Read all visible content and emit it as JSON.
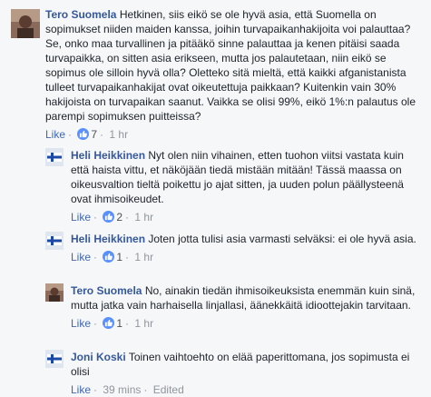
{
  "comments": [
    {
      "author": "Tero Suomela",
      "text": "Hetkinen, siis eikö se ole hyvä asia, että Suomella on sopimukset niiden maiden kanssa, joihin turvapaikanhakijoita voi palauttaa? Se, onko maa turvallinen ja pitääkö sinne palauttaa ja kenen pitäisi saada turvapaikka, on sitten asia erikseen, mutta jos palautetaan, niin eikö se sopimus ole silloin hyvä olla? Oletteko sitä mieltä, että kaikki afganistanista tulleet turvapaikanhakijat ovat oikeutettuja paikkaan? Kuitenkin vain 30% hakijoista on turvapaikan saanut. Vaikka se olisi 99%, eikö 1%:n palautus ole parempi sopimuksen puitteissa?",
      "like_label": "Like",
      "reaction_count": "7",
      "time": "1 hr",
      "edited": ""
    },
    {
      "author": "Heli Heikkinen",
      "text": "Nyt olen niin vihainen, etten tuohon viitsi vastata kuin että haista vittu, et näköjään tiedä mistään mitään! Tässä maassa on oikeusvaltion tieltä poikettu jo ajat sitten, ja uuden polun päällysteenä ovat ihmisoikeudet.",
      "like_label": "Like",
      "reaction_count": "2",
      "time": "1 hr",
      "edited": ""
    },
    {
      "author": "Heli Heikkinen",
      "text": "Joten jotta tulisi asia varmasti selväksi: ei ole hyvä asia.",
      "like_label": "Like",
      "reaction_count": "1",
      "time": "1 hr",
      "edited": ""
    },
    {
      "author": "Tero Suomela",
      "text": "No, ainakin tiedän ihmisoikeuksista enemmän kuin sinä, mutta jatka vain harhaisella linjallasi, äänekkäitä idioottejakin tarvitaan.",
      "like_label": "Like",
      "reaction_count": "1",
      "time": "1 hr",
      "edited": ""
    },
    {
      "author": "Joni Koski",
      "text": "Toinen vaihtoehto on elää paperittomana, jos sopimusta ei olisi",
      "like_label": "Like",
      "reaction_count": "",
      "time": "39 mins",
      "edited": "Edited"
    }
  ],
  "icons": {
    "reaction": "thumbs-up-icon"
  },
  "colors": {
    "author": "#365899",
    "like": "#4267b2",
    "reaction_bubble": "#5890ff",
    "meta": "#90949c"
  }
}
